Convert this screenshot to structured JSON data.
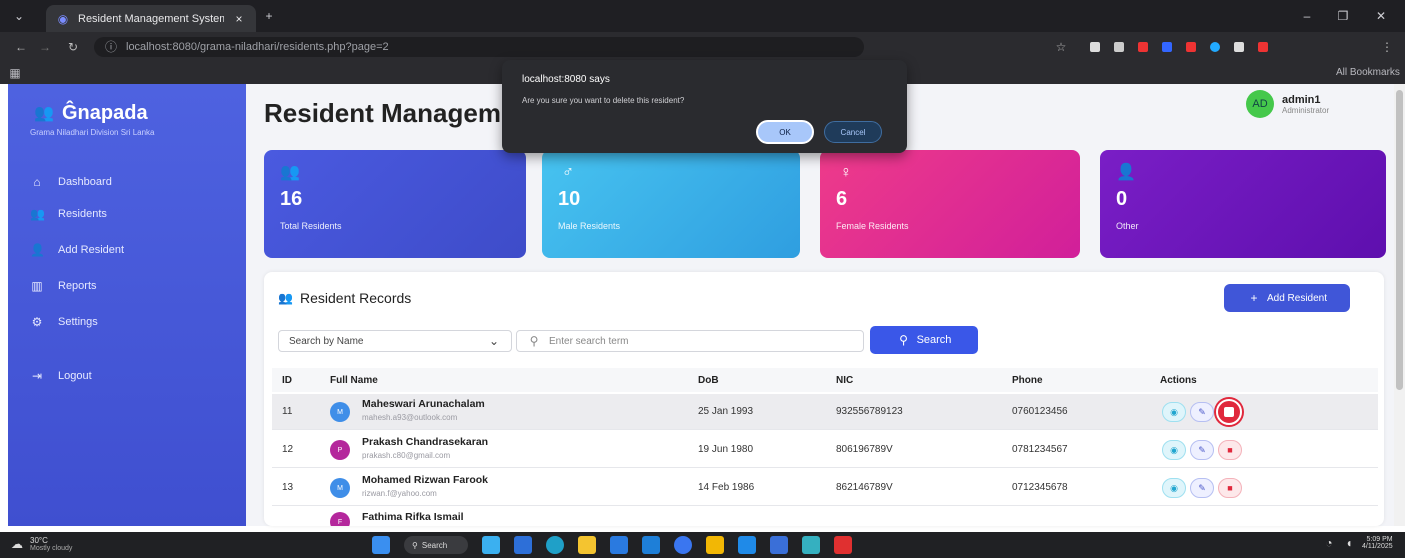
{
  "browser": {
    "tab_title": "Resident Management System",
    "url": "localhost:8080/grama-niladhari/residents.php?page=2",
    "bookmarks_label": "All Bookmarks"
  },
  "dialog": {
    "title": "localhost:8080 says",
    "message": "Are you sure you want to delete this resident?",
    "ok_label": "OK",
    "cancel_label": "Cancel"
  },
  "sidebar": {
    "brand": "Ĝnapada",
    "subtitle": "Grama Niladhari Division Sri Lanka",
    "items": [
      {
        "label": "Dashboard",
        "icon": "home-icon"
      },
      {
        "label": "Residents",
        "icon": "users-icon"
      },
      {
        "label": "Add Resident",
        "icon": "user-plus-icon"
      },
      {
        "label": "Reports",
        "icon": "chart-icon"
      },
      {
        "label": "Settings",
        "icon": "gear-icon"
      },
      {
        "label": "Logout",
        "icon": "logout-icon"
      }
    ]
  },
  "header": {
    "title": "Resident Management",
    "user_initials": "AD",
    "user_name": "admin1",
    "user_role": "Administrator"
  },
  "stats": [
    {
      "value": "16",
      "label": "Total Residents",
      "color": "#4a5ae0"
    },
    {
      "value": "10",
      "label": "Male Residents",
      "color": "#3fb2ea"
    },
    {
      "value": "6",
      "label": "Female Residents",
      "color": "#e5288e"
    },
    {
      "value": "0",
      "label": "Other",
      "color": "#6a14b9"
    }
  ],
  "records": {
    "title": "Resident Records",
    "add_button": "Add Resident",
    "search_by": "Search by Name",
    "search_placeholder": "Enter search term",
    "search_button": "Search",
    "columns": [
      "ID",
      "Full Name",
      "DoB",
      "NIC",
      "Phone",
      "Actions"
    ],
    "rows": [
      {
        "id": "11",
        "initials": "M",
        "avatar_color": "#3f8ee8",
        "name": "Maheswari Arunachalam",
        "email": "mahesh.a93@outlook.com",
        "dob": "25 Jan 1993",
        "nic": "932556789123",
        "phone": "0760123456"
      },
      {
        "id": "12",
        "initials": "P",
        "avatar_color": "#b4279c",
        "name": "Prakash Chandrasekaran",
        "email": "prakash.c80@gmail.com",
        "dob": "19 Jun 1980",
        "nic": "806196789V",
        "phone": "0781234567"
      },
      {
        "id": "13",
        "initials": "M",
        "avatar_color": "#3f8ee8",
        "name": "Mohamed Rizwan Farook",
        "email": "rizwan.f@yahoo.com",
        "dob": "14 Feb 1986",
        "nic": "862146789V",
        "phone": "0712345678"
      },
      {
        "id": "",
        "initials": "F",
        "avatar_color": "#b4279c",
        "name": "Fathima Rifka Ismail",
        "email": "",
        "dob": "",
        "nic": "",
        "phone": ""
      }
    ]
  },
  "taskbar": {
    "weather_temp": "30°C",
    "weather_desc": "Mostly cloudy",
    "search_label": "Search",
    "time": "5:09 PM",
    "date": "4/11/2025"
  }
}
